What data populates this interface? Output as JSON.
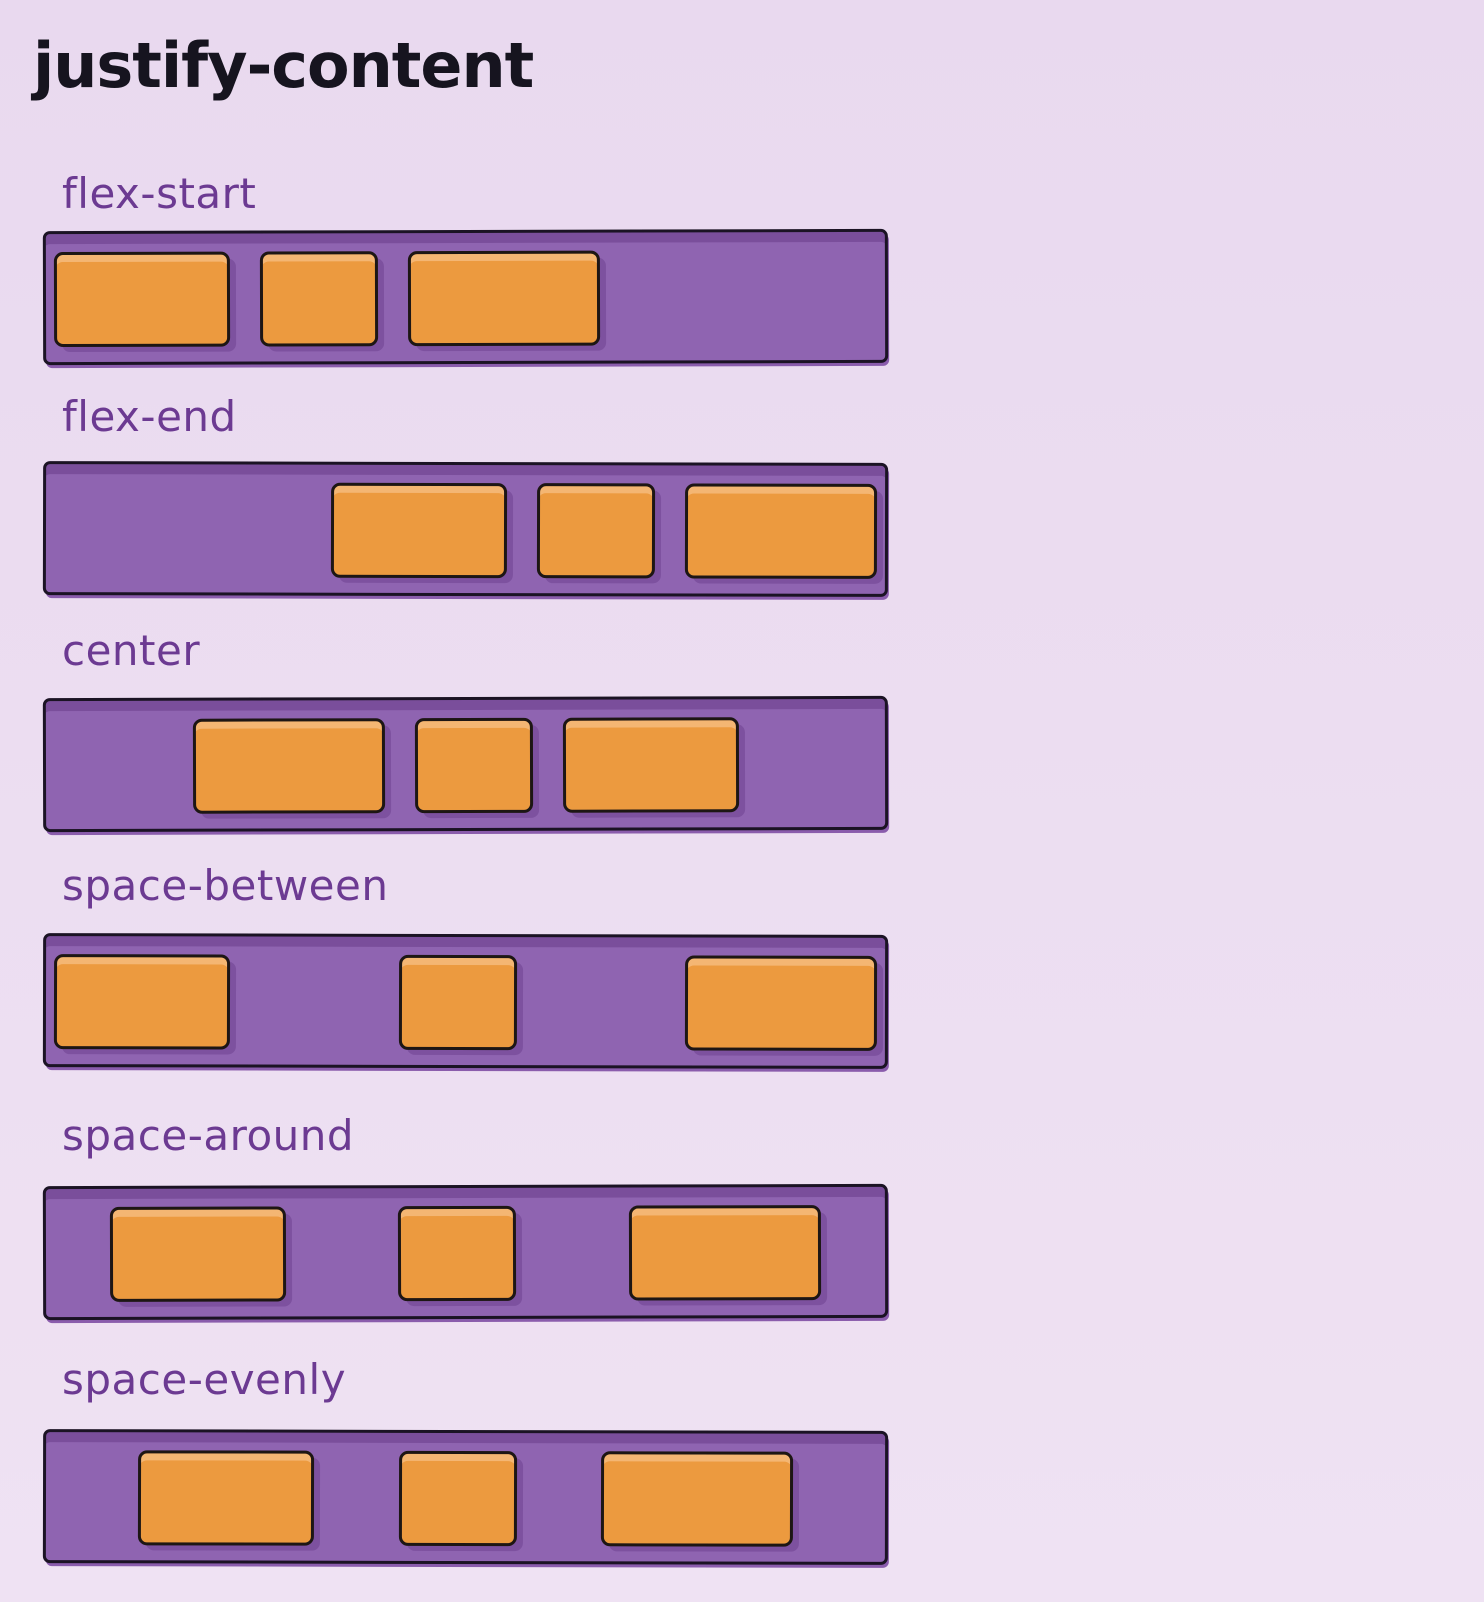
{
  "title": "justify-content",
  "colors": {
    "background": "#ebdcf0",
    "container": "#8f64b1",
    "item": "#ec9a3f",
    "label": "#6c3a92",
    "outline": "#1b1324"
  },
  "sections": [
    {
      "label": "flex-start",
      "justify": "flex-start",
      "item_count": 3
    },
    {
      "label": "flex-end",
      "justify": "flex-end",
      "item_count": 3
    },
    {
      "label": "center",
      "justify": "center",
      "item_count": 3
    },
    {
      "label": "space-between",
      "justify": "space-between",
      "item_count": 3
    },
    {
      "label": "space-around",
      "justify": "space-around",
      "item_count": 3
    },
    {
      "label": "space-evenly",
      "justify": "space-evenly",
      "item_count": 3
    }
  ]
}
